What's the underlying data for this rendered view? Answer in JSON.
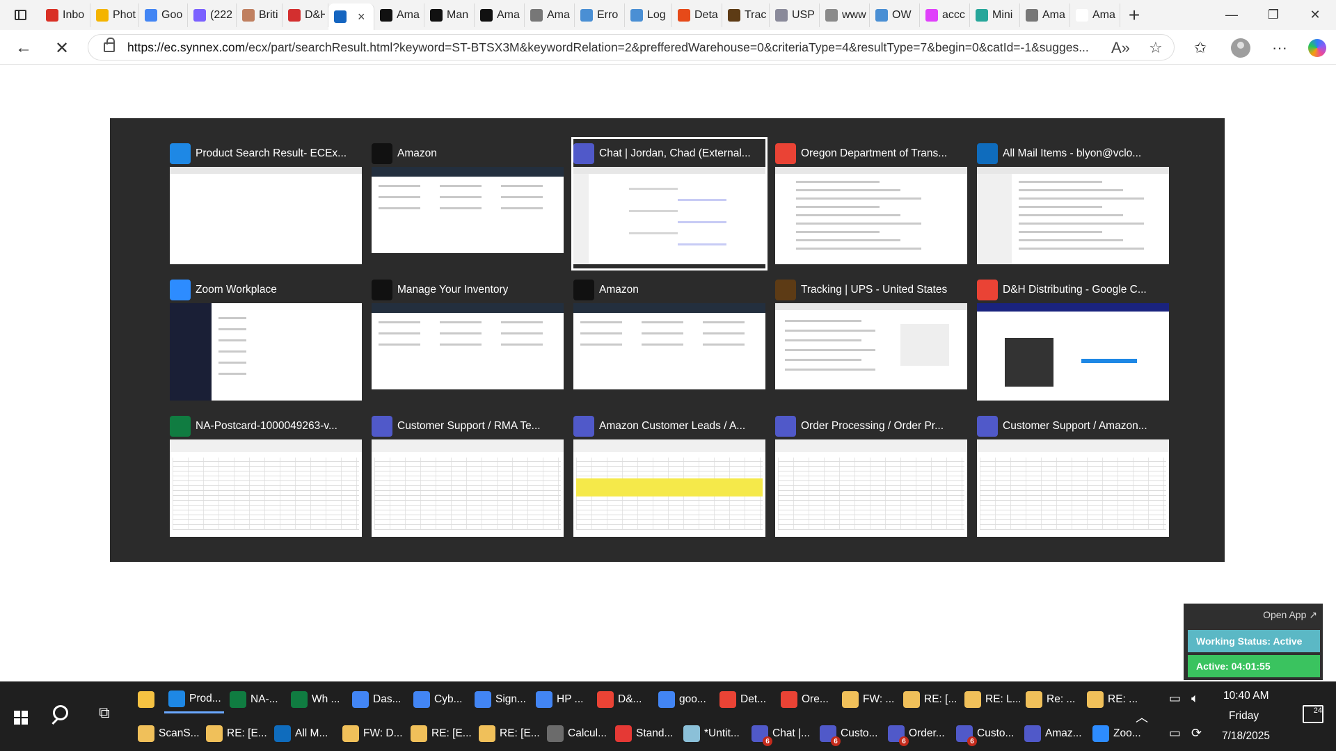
{
  "browser": {
    "tabs": [
      {
        "label": "Inbo",
        "icon": "gmail-icon",
        "color": "#d93025"
      },
      {
        "label": "Phot",
        "icon": "photos-icon",
        "color": "#f4b400"
      },
      {
        "label": "Goo",
        "icon": "google-icon",
        "color": "#4285f4"
      },
      {
        "label": "(222",
        "icon": "mail-icon",
        "color": "#7b61ff"
      },
      {
        "label": "Briti",
        "icon": "site-icon",
        "color": "#c08060"
      },
      {
        "label": "D&H",
        "icon": "dh-icon",
        "color": "#d32f2f"
      },
      {
        "label": "",
        "icon": "synnex-icon",
        "color": "#1565c0",
        "active": true
      },
      {
        "label": "Ama",
        "icon": "amazon-icon",
        "color": "#111111"
      },
      {
        "label": "Man",
        "icon": "amazon-icon",
        "color": "#111111"
      },
      {
        "label": "Ama",
        "icon": "amazon-icon",
        "color": "#111111"
      },
      {
        "label": "Ama",
        "icon": "amazon-icon",
        "color": "#777777"
      },
      {
        "label": "Erro",
        "icon": "dell-icon",
        "color": "#4a8fd4"
      },
      {
        "label": "Log",
        "icon": "site-icon",
        "color": "#4a8fd4"
      },
      {
        "label": "Deta",
        "icon": "fedex-icon",
        "color": "#e64a19"
      },
      {
        "label": "Trac",
        "icon": "ups-icon",
        "color": "#5d3b15"
      },
      {
        "label": "USP",
        "icon": "usps-icon",
        "color": "#8a8a9a"
      },
      {
        "label": "www",
        "icon": "site-icon",
        "color": "#8a8a8a"
      },
      {
        "label": "OW",
        "icon": "site-icon",
        "color": "#4a8fd4"
      },
      {
        "label": "accc",
        "icon": "site-icon",
        "color": "#e040fb"
      },
      {
        "label": "Mini",
        "icon": "site-icon",
        "color": "#26a69a"
      },
      {
        "label": "Ama",
        "icon": "amazon-icon",
        "color": "#777777"
      },
      {
        "label": "Ama",
        "icon": "amazon-icon",
        "color": "#ffffff"
      }
    ],
    "active_tab_close": "×",
    "new_tab": "+",
    "url_host": "https://ec.synnex.com",
    "url_rest": "/ecx/part/searchResult.html?keyword=ST-BTSX3M&keywordRelation=2&prefferedWarehouse=0&criteriaType=4&resultType=7&begin=0&catId=-1&sugges..."
  },
  "switcher": {
    "windows": [
      {
        "title": "Product Search Result- ECEx...",
        "app": "edge",
        "color": "#1e88e5",
        "thumb": "blank"
      },
      {
        "title": "Amazon",
        "app": "amazon",
        "color": "#111111",
        "thumb": "amazon"
      },
      {
        "title": "Chat | Jordan, Chad (External...",
        "app": "teams",
        "color": "#5059c9",
        "thumb": "chat",
        "selected": true
      },
      {
        "title": "Oregon Department of Trans...",
        "app": "chrome",
        "color": "#ea4335",
        "thumb": "search"
      },
      {
        "title": "All Mail Items - blyon@vclo...",
        "app": "outlook",
        "color": "#0f6cbd",
        "thumb": "mail"
      },
      {
        "title": "Zoom Workplace",
        "app": "zoom",
        "color": "#2d8cff",
        "thumb": "zoom"
      },
      {
        "title": "Manage Your Inventory",
        "app": "amazon",
        "color": "#111111",
        "thumb": "amazon"
      },
      {
        "title": "Amazon",
        "app": "amazon",
        "color": "#111111",
        "thumb": "amazon"
      },
      {
        "title": "Tracking | UPS - United States",
        "app": "ups",
        "color": "#5d3b15",
        "thumb": "ups"
      },
      {
        "title": "D&H Distributing - Google C...",
        "app": "chrome",
        "color": "#ea4335",
        "thumb": "dh"
      },
      {
        "title": "NA-Postcard-1000049263-v...",
        "app": "excel",
        "color": "#107c41",
        "thumb": "sheet"
      },
      {
        "title": "Customer Support / RMA Te...",
        "app": "teams",
        "color": "#5059c9",
        "thumb": "sheet"
      },
      {
        "title": "Amazon Customer Leads / A...",
        "app": "teams",
        "color": "#5059c9",
        "thumb": "sheet-yellow"
      },
      {
        "title": "Order Processing / Order Pr...",
        "app": "teams",
        "color": "#5059c9",
        "thumb": "sheet"
      },
      {
        "title": "Customer Support / Amazon...",
        "app": "teams",
        "color": "#5059c9",
        "thumb": "sheet"
      }
    ]
  },
  "widget": {
    "open_app": "Open App ↗",
    "working_status": "Working Status: Active",
    "active_time": "Active: 04:01:55"
  },
  "taskbar": {
    "row1": [
      {
        "label": "",
        "icon": "file-explorer-icon",
        "color": "#f5c242"
      },
      {
        "label": "Prod...",
        "icon": "edge-icon",
        "color": "#1e88e5",
        "active": true
      },
      {
        "label": "NA-...",
        "icon": "excel-icon",
        "color": "#107c41"
      },
      {
        "label": "Wh ...",
        "icon": "excel-icon",
        "color": "#107c41"
      },
      {
        "label": "Das...",
        "icon": "chrome-icon",
        "color": "#4285f4"
      },
      {
        "label": "Cyb...",
        "icon": "chrome-icon",
        "color": "#4285f4"
      },
      {
        "label": "Sign...",
        "icon": "chrome-icon",
        "color": "#4285f4"
      },
      {
        "label": "HP ...",
        "icon": "chrome-icon",
        "color": "#4285f4"
      },
      {
        "label": "D&...",
        "icon": "chrome-icon",
        "color": "#ea4335"
      },
      {
        "label": "goo...",
        "icon": "chrome-icon",
        "color": "#4285f4"
      },
      {
        "label": "Det...",
        "icon": "chrome-icon",
        "color": "#ea4335"
      },
      {
        "label": "Ore...",
        "icon": "chrome-icon",
        "color": "#ea4335"
      },
      {
        "label": "FW: ...",
        "icon": "mail-icon",
        "color": "#f0c05a"
      },
      {
        "label": "RE: [...",
        "icon": "mail-icon",
        "color": "#f0c05a"
      },
      {
        "label": "RE: L...",
        "icon": "mail-icon",
        "color": "#f0c05a"
      },
      {
        "label": "Re: ...",
        "icon": "mail-icon",
        "color": "#f0c05a"
      },
      {
        "label": "RE: ...",
        "icon": "mail-icon",
        "color": "#f0c05a"
      }
    ],
    "row2": [
      {
        "label": "ScanS...",
        "icon": "mail-icon",
        "color": "#f0c05a"
      },
      {
        "label": "RE: [E...",
        "icon": "mail-icon",
        "color": "#f0c05a"
      },
      {
        "label": "All M...",
        "icon": "outlook-icon",
        "color": "#0f6cbd"
      },
      {
        "label": "FW: D...",
        "icon": "mail-icon",
        "color": "#f0c05a"
      },
      {
        "label": "RE: [E...",
        "icon": "mail-icon",
        "color": "#f0c05a"
      },
      {
        "label": "RE: [E...",
        "icon": "mail-icon",
        "color": "#f0c05a"
      },
      {
        "label": "Calcul...",
        "icon": "calculator-icon",
        "color": "#6b6b6b"
      },
      {
        "label": "Stand...",
        "icon": "pdf-icon",
        "color": "#e53935"
      },
      {
        "label": "*Untit...",
        "icon": "paint-icon",
        "color": "#8bc0d8"
      },
      {
        "label": "Chat |...",
        "icon": "teams-icon",
        "color": "#5059c9",
        "badge": "6"
      },
      {
        "label": "Custo...",
        "icon": "teams-icon",
        "color": "#5059c9",
        "badge": "6"
      },
      {
        "label": "Order...",
        "icon": "teams-icon",
        "color": "#5059c9",
        "badge": "6"
      },
      {
        "label": "Custo...",
        "icon": "teams-icon",
        "color": "#5059c9",
        "badge": "6"
      },
      {
        "label": "Amaz...",
        "icon": "teams-icon",
        "color": "#5059c9"
      },
      {
        "label": "Zoo...",
        "icon": "zoom-icon",
        "color": "#2d8cff"
      }
    ],
    "clock_time": "10:40 AM",
    "clock_day": "Friday",
    "clock_date": "7/18/2025",
    "notifications": "24"
  }
}
